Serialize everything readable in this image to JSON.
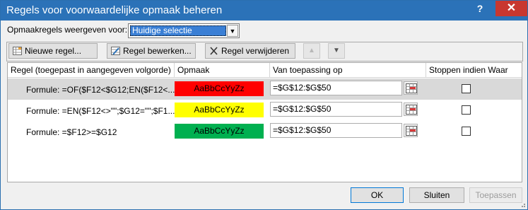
{
  "window": {
    "title": "Regels voor voorwaardelijke opmaak beheren",
    "help": "?",
    "close": "✕"
  },
  "show_for": {
    "label": "Opmaakregels weergeven voor:",
    "value": "Huidige selectie",
    "arrow": "▼"
  },
  "toolbar": {
    "new_rule": "Nieuwe regel...",
    "edit_rule": "Regel bewerken...",
    "delete_rule": "Regel verwijderen",
    "move_up": "▲",
    "move_down": "▼"
  },
  "table": {
    "headers": {
      "rule": "Regel (toegepast in aangegeven volgorde)",
      "format": "Opmaak",
      "applies_to": "Van toepassing op",
      "stop_if_true": "Stoppen indien Waar"
    },
    "rows": [
      {
        "formula": "Formule: =OF($F12<$G12;EN($F12<...",
        "preview": "AaBbCcYyZz",
        "preview_color": "#ff0000",
        "range": "=$G$12:$G$50",
        "stop": false,
        "selected": true
      },
      {
        "formula": "Formule: =EN($F12<>\"\";$G12=\"\";$F1...",
        "preview": "AaBbCcYyZz",
        "preview_color": "#ffff00",
        "range": "=$G$12:$G$50",
        "stop": false,
        "selected": false
      },
      {
        "formula": "Formule: =$F12>=$G12",
        "preview": "AaBbCcYyZz",
        "preview_color": "#00b050",
        "range": "=$G$12:$G$50",
        "stop": false,
        "selected": false
      }
    ]
  },
  "footer": {
    "ok": "OK",
    "close": "Sluiten",
    "apply": "Toepassen"
  },
  "colors": {
    "titlebar": "#2b72b8",
    "close_button": "#c8372f",
    "selection": "#d9d9d9"
  }
}
